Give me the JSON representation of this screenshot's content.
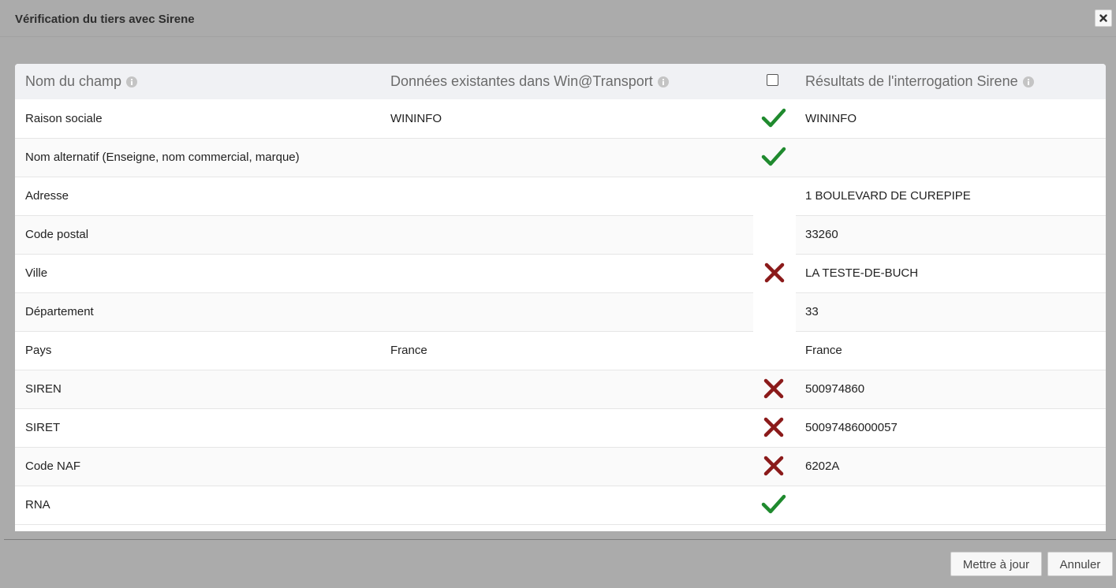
{
  "dialog": {
    "title": "Vérification du tiers avec Sirene",
    "close_icon": "close-icon"
  },
  "table": {
    "headers": {
      "field": "Nom du champ",
      "existing": "Données existantes dans Win@Transport",
      "results": "Résultats de l'interrogation Sirene",
      "info_icon": "info-icon"
    },
    "rows": [
      {
        "field": "Raison sociale",
        "existing": "WININFO",
        "result": "WININFO",
        "status": "match"
      },
      {
        "field": "Nom alternatif (Enseigne, nom commercial, marque)",
        "existing": "",
        "result": "",
        "status": "match"
      },
      {
        "field": "Adresse",
        "existing": "",
        "result": "1 BOULEVARD DE CUREPIPE",
        "status": "mismatch-group"
      },
      {
        "field": "Code postal",
        "existing": "",
        "result": "33260",
        "status": "mismatch-group"
      },
      {
        "field": "Ville",
        "existing": "",
        "result": "LA TESTE-DE-BUCH",
        "status": "mismatch-group"
      },
      {
        "field": "Département",
        "existing": "",
        "result": "33",
        "status": "mismatch-group"
      },
      {
        "field": "Pays",
        "existing": "France",
        "result": "France",
        "status": "mismatch-group"
      },
      {
        "field": "SIREN",
        "existing": "",
        "result": "500974860",
        "status": "mismatch"
      },
      {
        "field": "SIRET",
        "existing": "",
        "result": "50097486000057",
        "status": "mismatch"
      },
      {
        "field": "Code NAF",
        "existing": "",
        "result": "6202A",
        "status": "mismatch"
      },
      {
        "field": "RNA",
        "existing": "",
        "result": "",
        "status": "match"
      }
    ],
    "colors": {
      "match": "#1f8a2e",
      "mismatch": "#8b1a1a"
    }
  },
  "footer": {
    "update_label": "Mettre à jour",
    "cancel_label": "Annuler"
  }
}
